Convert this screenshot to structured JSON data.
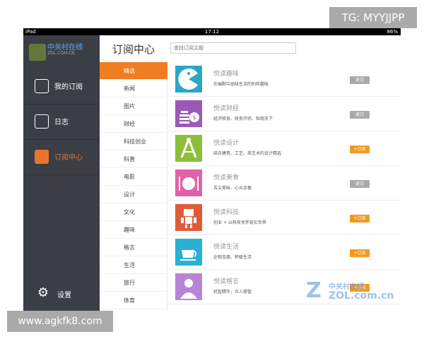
{
  "tag": "TG: MYYJJPP",
  "watermark_url": "www.agkfk8.com",
  "statusbar": {
    "left": "iPad",
    "time": "17:12",
    "battery": "86%"
  },
  "logo": {
    "name": "中关村在线",
    "sub": "ZOL.COM.CN"
  },
  "sidebar": {
    "items": [
      {
        "label": "我的订阅",
        "icon": "chart-icon"
      },
      {
        "label": "日志",
        "icon": "profile-icon"
      },
      {
        "label": "订阅中心",
        "icon": "subscribe-icon"
      }
    ],
    "settings_label": "设置"
  },
  "header": {
    "title": "订阅中心",
    "search_placeholder": "查找订阅主题"
  },
  "categories": [
    "精选",
    "新闻",
    "图片",
    "财经",
    "科技创业",
    "科普",
    "电影",
    "设计",
    "文化",
    "趣味",
    "格言",
    "生活",
    "旅行",
    "体育"
  ],
  "feed": [
    {
      "title": "悦读趣味",
      "desc": "在幽默中品味生活的别样趣味",
      "button": "退订",
      "color": "#2aa6c8"
    },
    {
      "title": "悦读财经",
      "desc": "经济修身、财务开窍、纵观天下",
      "button": "退订",
      "color": "#9b59b6"
    },
    {
      "title": "悦读设计",
      "desc": "结合建筑、工艺、商艺术的设计精选",
      "button": "+订阅",
      "color": "#8bbf3a"
    },
    {
      "title": "悦读美食",
      "desc": "舌尖美味、心头余香",
      "button": "退订",
      "color": "#e063a9"
    },
    {
      "title": "悦读科技",
      "desc": "创业 + 以科技关怀现实世界",
      "button": "+订阅",
      "color": "#e05a3a"
    },
    {
      "title": "悦读生活",
      "desc": "达观态度、积极生活",
      "button": "+订阅",
      "color": "#2ab0d6"
    },
    {
      "title": "悦读格言",
      "desc": "机智精华，众人睿智",
      "button": "+订阅",
      "color": "#b884d6"
    }
  ],
  "zol_watermark": {
    "line1": "中关村在线",
    "line2": "ZOL.com.cn"
  }
}
